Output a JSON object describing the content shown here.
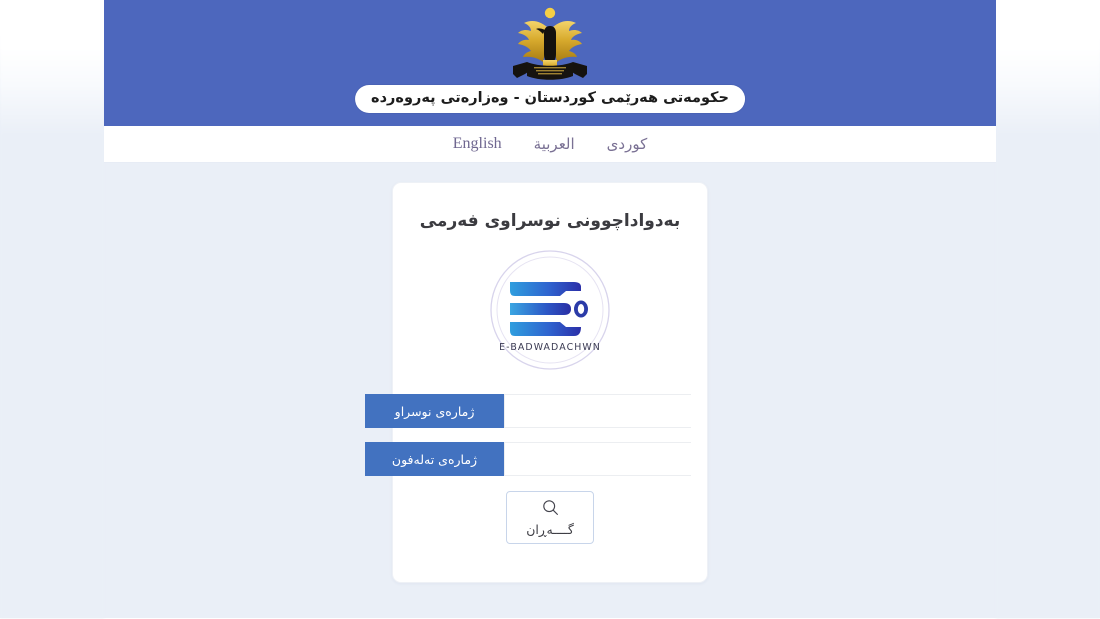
{
  "header": {
    "emblem_icon": "kurdistan-eagle-emblem",
    "banner_text": "حکومەتی هەرێمی کوردستان - وەزارەتی پەروەردە",
    "background_color": "#4d67bd"
  },
  "language_nav": {
    "items": [
      {
        "label": "کوردی",
        "script": "arabic"
      },
      {
        "label": "العربية",
        "script": "arabic"
      },
      {
        "label": "English",
        "script": "latin"
      }
    ],
    "text_color": "#7a7194"
  },
  "card": {
    "title": "بەدواداچوونی نوسراوی فەرمی",
    "logo": {
      "icon": "e-badwadachwn-logo",
      "wordmark": "E-BADWADACHWN",
      "gradient_from": "#2f9ede",
      "gradient_to": "#2b2fa8"
    },
    "form": {
      "fields": [
        {
          "label": "ژمارەی نوسراو",
          "value": "",
          "placeholder": "",
          "name": "document-number"
        },
        {
          "label": "ژمارەی تەلەفون",
          "value": "",
          "placeholder": "",
          "name": "phone-number"
        }
      ],
      "label_background": "#4272c0",
      "submit": {
        "label": "گــــەڕان",
        "icon": "search-icon",
        "border_color": "#c8d5ea"
      }
    }
  },
  "colors": {
    "page_background": "#eaeff7",
    "card_background": "#ffffff",
    "accent_blue": "#4d67bd"
  }
}
